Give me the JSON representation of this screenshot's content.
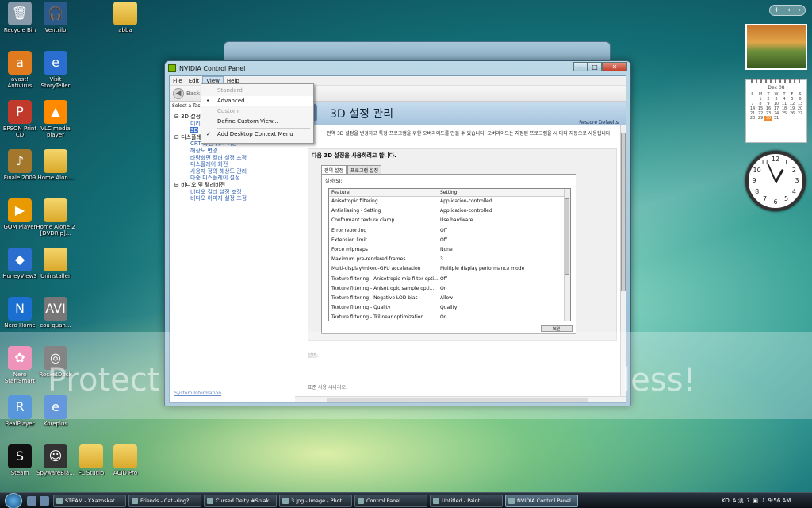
{
  "desktop": {
    "icons": [
      {
        "label": "Recycle Bin",
        "glyph": "🗑"
      },
      {
        "label": "Ventrilo",
        "glyph": "🎧"
      },
      {
        "label": "abba",
        "glyph": ""
      },
      {
        "label": "avast! Antivirus",
        "glyph": "a"
      },
      {
        "label": "Visit StoryTeller",
        "glyph": "e"
      },
      {
        "label": "EPSON Print CD",
        "glyph": "P"
      },
      {
        "label": "VLC media player",
        "glyph": "▲"
      },
      {
        "label": "Finale 2009",
        "glyph": "♪"
      },
      {
        "label": "Home.Alon...",
        "glyph": ""
      },
      {
        "label": "GOM Player",
        "glyph": "▶"
      },
      {
        "label": "Home Alone 2 [DVDRip]...",
        "glyph": ""
      },
      {
        "label": "HoneyView3",
        "glyph": "◆"
      },
      {
        "label": "Uninstaller",
        "glyph": ""
      },
      {
        "label": "Nero Home",
        "glyph": "N"
      },
      {
        "label": "coa-quan...",
        "glyph": "AVI"
      },
      {
        "label": "Nero StartSmart",
        "glyph": "✿"
      },
      {
        "label": "RocketDock",
        "glyph": "◎"
      },
      {
        "label": "RealPlayer",
        "glyph": "R"
      },
      {
        "label": "Koreplus",
        "glyph": "e"
      },
      {
        "label": "Steam",
        "glyph": "S"
      },
      {
        "label": "SpywareBla...",
        "glyph": "☺"
      },
      {
        "label": "FL Studio",
        "glyph": ""
      },
      {
        "label": "ACID Pro",
        "glyph": ""
      }
    ]
  },
  "gadgets": {
    "calendar": {
      "month": "Dec 08",
      "weekdays": [
        "S",
        "M",
        "T",
        "W",
        "T",
        "F",
        "S"
      ],
      "weeks": [
        [
          "",
          "1",
          "2",
          "3",
          "4",
          "5",
          "6"
        ],
        [
          "7",
          "8",
          "9",
          "10",
          "11",
          "12",
          "13"
        ],
        [
          "14",
          "15",
          "16",
          "17",
          "18",
          "19",
          "20"
        ],
        [
          "21",
          "22",
          "23",
          "24",
          "25",
          "26",
          "27"
        ],
        [
          "28",
          "29",
          "30",
          "31",
          "",
          "",
          ""
        ]
      ],
      "today": "30"
    },
    "clock_numbers": [
      "12",
      "1",
      "2",
      "3",
      "4",
      "5",
      "6",
      "7",
      "8",
      "9",
      "10",
      "11"
    ]
  },
  "window": {
    "title": "NVIDIA Control Panel",
    "menu": [
      "File",
      "Edit",
      "View",
      "Help"
    ],
    "active_menu": "View",
    "back_label": "Back",
    "task_label": "Select a Task...",
    "tree": [
      {
        "text": "3D 설정",
        "level": 0
      },
      {
        "text": "미리",
        "level": 1
      },
      {
        "text": "3D",
        "level": 1,
        "selected": true
      },
      {
        "text": "디스플레이",
        "level": 0
      },
      {
        "text": "CRT 화면 위치 이동",
        "level": 1
      },
      {
        "text": "해상도 변경",
        "level": 1
      },
      {
        "text": "바탕화면 컬러 설정 조정",
        "level": 1
      },
      {
        "text": "디스플레이 회전",
        "level": 1
      },
      {
        "text": "사용자 정의 해상도 관리",
        "level": 1
      },
      {
        "text": "다중 디스플레이 설정",
        "level": 1
      },
      {
        "text": "비디오 및 텔레비전",
        "level": 0
      },
      {
        "text": "비디오 컬러 설정 조정",
        "level": 1
      },
      {
        "text": "비디오 이미지 설정 조정",
        "level": 1
      }
    ],
    "system_info": "System Information",
    "page_title": "3D 설정 관리",
    "restore_defaults": "Restore Defaults",
    "description": "전역 3D 설정을 변경하고 특정 프로그램을 위한 오버라이드를 만들 수 있습니다. 오버라이드는 지정된 프로그램을 시 마다 자동으로 사용됩니다.",
    "group_title": "다음 3D 설정을 사용하려고 합니다.",
    "tabs": [
      "전역 설정",
      "프로그램 설정"
    ],
    "settings_label": "설정(S):",
    "columns": [
      "Feature",
      "Setting"
    ],
    "rows": [
      [
        "Anisotropic filtering",
        "Application-controlled"
      ],
      [
        "Antialiasing - Setting",
        "Application-controlled"
      ],
      [
        "Conformant texture clamp",
        "Use hardware"
      ],
      [
        "Error reporting",
        "Off"
      ],
      [
        "Extension limit",
        "Off"
      ],
      [
        "Force mipmaps",
        "None"
      ],
      [
        "Maximum pre-rendered frames",
        "3"
      ],
      [
        "Multi-display/mixed-GPU acceleration",
        "Multiple display performance mode"
      ],
      [
        "Texture filtering - Anisotropic mip filter opti...",
        "Off"
      ],
      [
        "Texture filtering - Anisotropic sample opti...",
        "On"
      ],
      [
        "Texture filtering - Negative LOD bias",
        "Allow"
      ],
      [
        "Texture filtering - Quality",
        "Quality"
      ],
      [
        "Texture filtering - Trilinear optimization",
        "On"
      ]
    ],
    "restore_button": "복원",
    "section_description": "설명:",
    "section_usage": "표준 사용 시나리오:"
  },
  "view_menu": {
    "items": [
      {
        "label": "Standard",
        "disabled": true
      },
      {
        "label": "Advanced",
        "mark": "•"
      },
      {
        "label": "Custom",
        "disabled": true
      },
      {
        "label": "Define Custom View...",
        "separator_after": true
      },
      {
        "label": "Add Desktop Context Menu",
        "mark": "✓"
      }
    ]
  },
  "watermark": {
    "left": "Protect",
    "right": "less!"
  },
  "taskbar": {
    "buttons": [
      {
        "label": "STEAM - XXaznskat..."
      },
      {
        "label": "Friends - Cat -ring?"
      },
      {
        "label": "Cursed Deity #Splak..."
      },
      {
        "label": "3.jpg - Image - Phot..."
      },
      {
        "label": "Control Panel"
      },
      {
        "label": "Untitled - Paint"
      },
      {
        "label": "NVIDIA Control Panel",
        "active": true
      }
    ],
    "tray": {
      "lang": "KO",
      "ime": "A 漢",
      "time": "9:56 AM"
    }
  }
}
